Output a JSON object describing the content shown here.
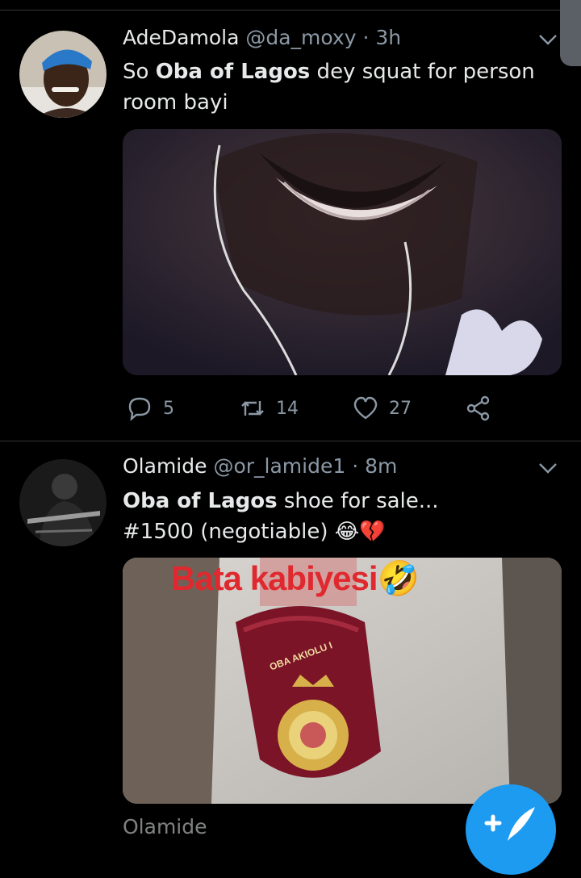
{
  "tweets": [
    {
      "name": "AdeDamola",
      "handle": "@da_moxy",
      "sep": "·",
      "time": "3h",
      "text_prefix": "So ",
      "text_bold": "Oba of Lagos",
      "text_suffix": " dey squat for person room bayi",
      "media_icon": "smiling-face-photo",
      "replies": "5",
      "retweets": "14",
      "likes": "27"
    },
    {
      "name": "Olamide",
      "handle": "@or_lamide1",
      "sep": "·",
      "time": "8m",
      "text_bold": "Oba of Lagos",
      "text_suffix": " shoe for sale...",
      "text_line2": "#1500 (negotiable) 😂💔",
      "media_caption": "Bata kabiyesi🤣",
      "media_badge_text": "OBA AKIOLU I",
      "media_icon": "red-slipper-photo"
    }
  ],
  "next_tweet_name": "Olamide",
  "colors": {
    "background": "#000000",
    "muted": "#8b98a5",
    "text": "#e7e9ea",
    "accent": "#1d9bf0",
    "divider": "#2f3336"
  },
  "icons": {
    "reply": "reply-icon",
    "retweet": "retweet-icon",
    "like": "heart-icon",
    "share": "share-icon",
    "more": "chevron-down-icon",
    "compose": "compose-icon"
  }
}
